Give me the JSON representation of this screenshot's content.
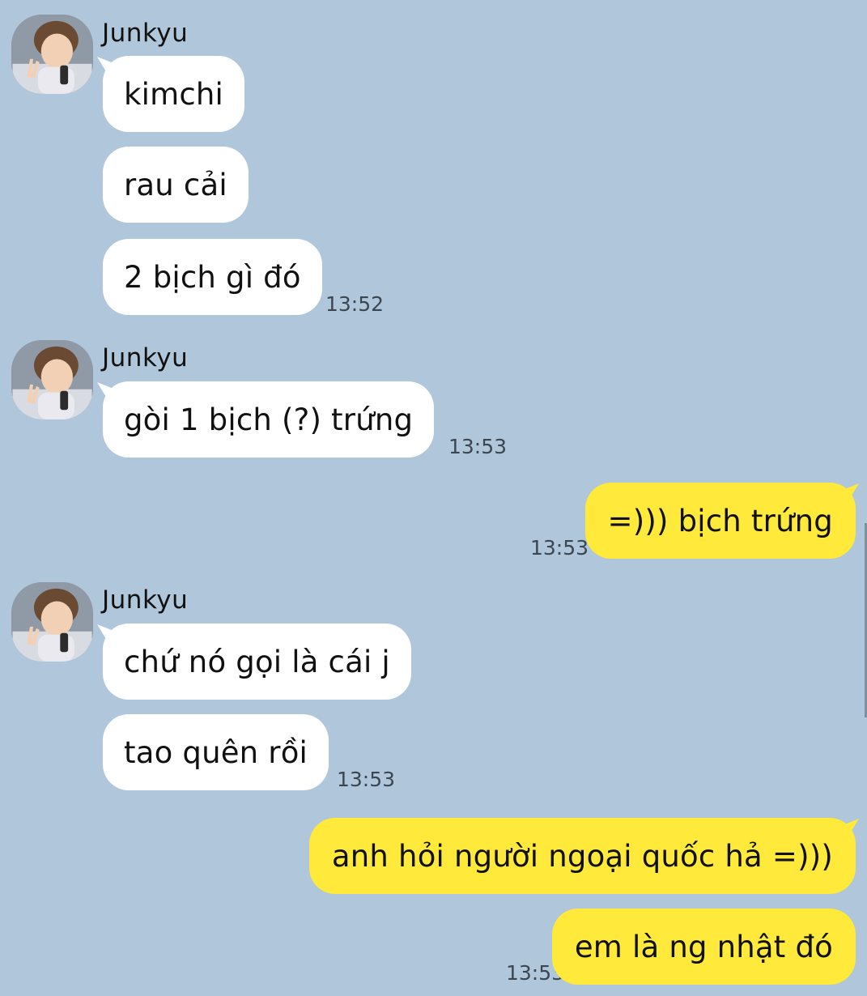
{
  "chat": {
    "contact_name": "Junkyu",
    "avatar_icon": "avatar-icon",
    "colors": {
      "background": "#b0c6da",
      "incoming_bubble": "#ffffff",
      "outgoing_bubble": "#ffe93b"
    },
    "messages": [
      {
        "sender": "Junkyu",
        "direction": "incoming",
        "text": "kimchi"
      },
      {
        "sender": "Junkyu",
        "direction": "incoming",
        "text": "rau cải"
      },
      {
        "sender": "Junkyu",
        "direction": "incoming",
        "text": "2 bịch gì đó",
        "time": "13:52"
      },
      {
        "sender": "Junkyu",
        "direction": "incoming",
        "text": "gòi 1 bịch (?) trứng",
        "time": "13:53"
      },
      {
        "sender": "me",
        "direction": "outgoing",
        "text": "=))) bịch trứng",
        "time": "13:53"
      },
      {
        "sender": "Junkyu",
        "direction": "incoming",
        "text": "chứ nó gọi là cái j"
      },
      {
        "sender": "Junkyu",
        "direction": "incoming",
        "text": "tao quên rồi",
        "time": "13:53"
      },
      {
        "sender": "me",
        "direction": "outgoing",
        "text": "anh hỏi người ngoại quốc hả =)))"
      },
      {
        "sender": "me",
        "direction": "outgoing",
        "text": "em là ng nhật đó",
        "time": "13:53"
      }
    ]
  }
}
